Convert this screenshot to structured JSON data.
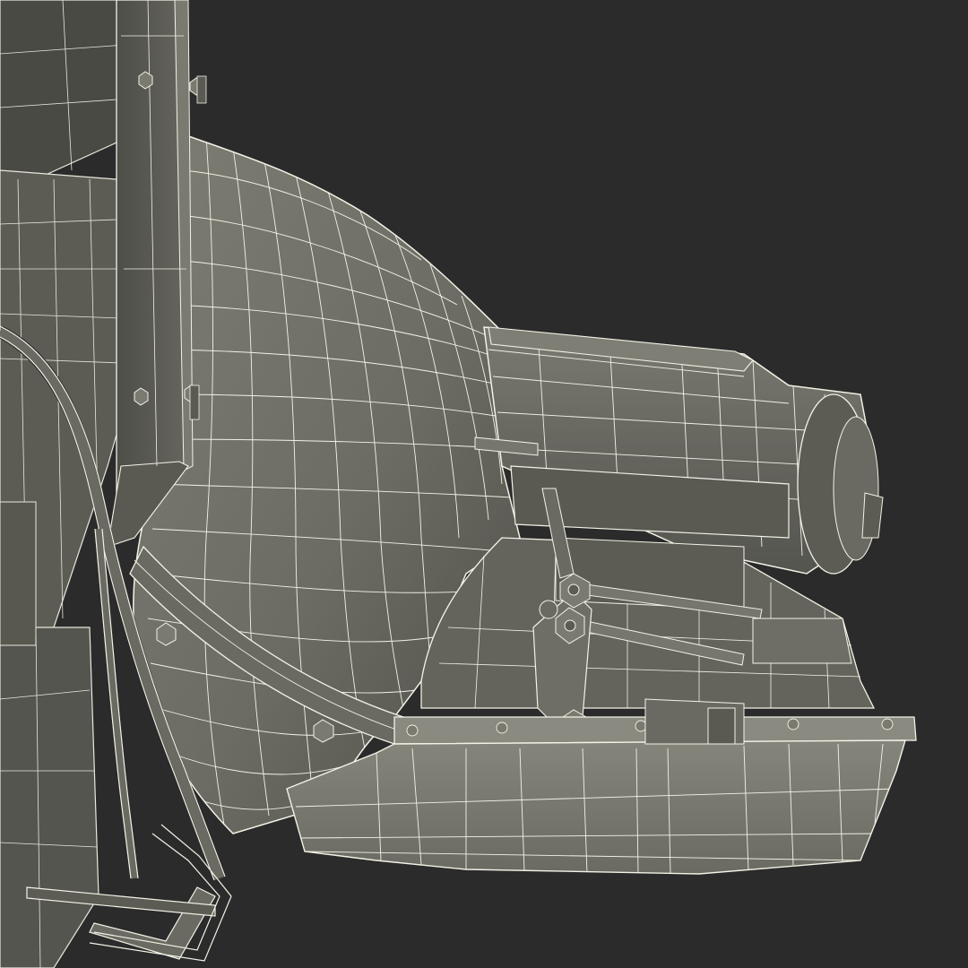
{
  "scene": {
    "subject": "transmission-wireframe-render",
    "colors": {
      "background": "#2b2b2b",
      "surface_light": "#8a8a80",
      "surface_mid": "#6e6e66",
      "surface_dark": "#4a4a44",
      "wire": "#f2f2e6",
      "shadow": "#3a3a36"
    }
  }
}
